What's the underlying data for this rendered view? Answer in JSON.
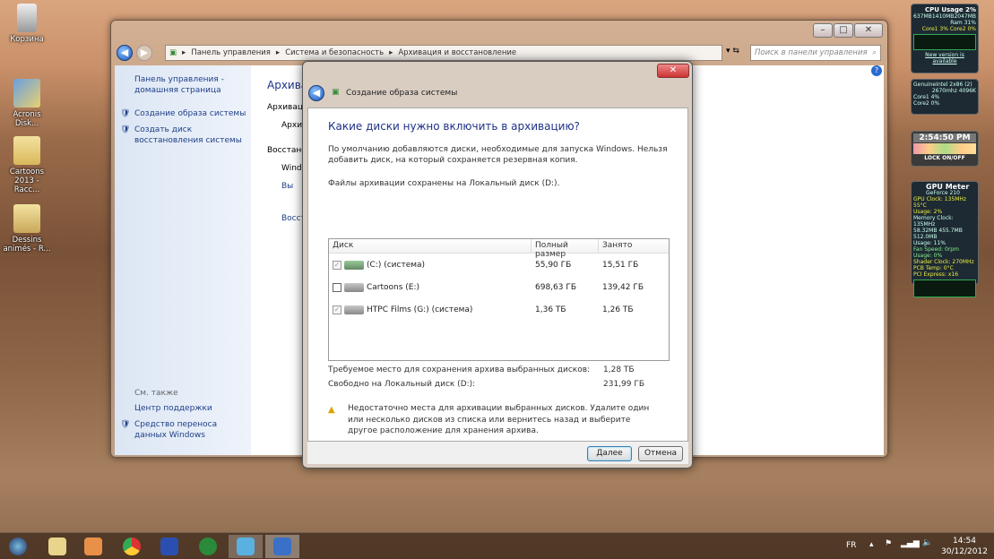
{
  "desktop": {
    "icons": [
      {
        "label": "Корзина"
      },
      {
        "label": "Acronis Disk..."
      },
      {
        "label": "Cartoons 2013 - Racc..."
      },
      {
        "label": "Dessins animés - R..."
      }
    ]
  },
  "window": {
    "breadcrumb": [
      "Панель управления",
      "Система и безопасность",
      "Архивация и восстановление"
    ],
    "search_placeholder": "Поиск в панели управления",
    "sidebar": {
      "home": "Панель управления - домашняя страница",
      "links": [
        "Создание образа системы",
        "Создать диск восстановления системы"
      ],
      "see_also": "См. также",
      "support": "Центр поддержки",
      "transfer": "Средство переноса данных Windows"
    },
    "content": {
      "title": "Архивация и восстановление файлов",
      "archive": "Архивация",
      "archive_sub": "Архив",
      "restore": "Восстановление",
      "windows": "Windows",
      "run": "Вы",
      "restore_link": "Восст"
    }
  },
  "dialog": {
    "title": "Создание образа системы",
    "heading": "Какие диски нужно включить в архивацию?",
    "desc": "По умолчанию добавляются диски, необходимые для запуска Windows. Нельзя добавить диск, на который сохраняется резервная копия.",
    "saved_on": "Файлы архивации сохранены на Локальный диск (D:).",
    "columns": [
      "Диск",
      "Полный размер",
      "Занято"
    ],
    "rows": [
      {
        "name": "(C:) (система)",
        "size": "55,90 ГБ",
        "used": "15,51 ГБ",
        "checked": true,
        "disabled": true
      },
      {
        "name": "Cartoons (E:)",
        "size": "698,63 ГБ",
        "used": "139,42 ГБ",
        "checked": false,
        "disabled": false
      },
      {
        "name": "HTPC Films (G:) (система)",
        "size": "1,36 ТБ",
        "used": "1,26 ТБ",
        "checked": true,
        "disabled": true
      }
    ],
    "required_label": "Требуемое место для сохранения архива выбранных дисков:",
    "required_value": "1,28 ТБ",
    "free_label": "Свободно на Локальный диск (D:):",
    "free_value": "231,99 ГБ",
    "warning": "Недостаточно места для архивации выбранных дисков. Удалите один или несколько дисков из списка или вернитесь назад и выберите другое расположение для хранения архива.",
    "next": "Далее",
    "cancel": "Отмена"
  },
  "gadgets": {
    "cpu": {
      "title": "CPU Usage",
      "value": "2%",
      "used": "637MB",
      "free": "1410MB",
      "total": "2047MB",
      "ram": "31%",
      "core1": "3%",
      "core2": "0%",
      "link": "New version is available"
    },
    "cpuinfo": {
      "name": "GenuineIntel 2x86 (2)",
      "freq": "2670mhz 4096K",
      "core1": "Core1 4%",
      "core2": "Core2 0%"
    },
    "clock": {
      "time": "2:54:50 PM",
      "lock": "LOCK ON/OFF"
    },
    "gpu": {
      "title": "GPU Meter",
      "model": "GeForce 210",
      "clock": "GPU Clock: 135MHz",
      "temp": "55°C",
      "usage": "Usage: 2%",
      "mem": "Memory Clock: 135MHz",
      "mem_vals": "58.32MB 455.7MB 512.0MB",
      "mem_usage": "Usage: 11%",
      "fan": "Fan Speed: 0rpm",
      "fan_usage": "Usage: 0%",
      "shader": "Shader Clock: 270MHz",
      "pcb": "PCB Temp: 0°C",
      "pci": "PCI Express: x16"
    }
  },
  "taskbar": {
    "lang": "FR",
    "time": "14:54",
    "date": "30/12/2012"
  },
  "colors": {
    "link": "#1e3f86",
    "heading": "#1e3287"
  }
}
